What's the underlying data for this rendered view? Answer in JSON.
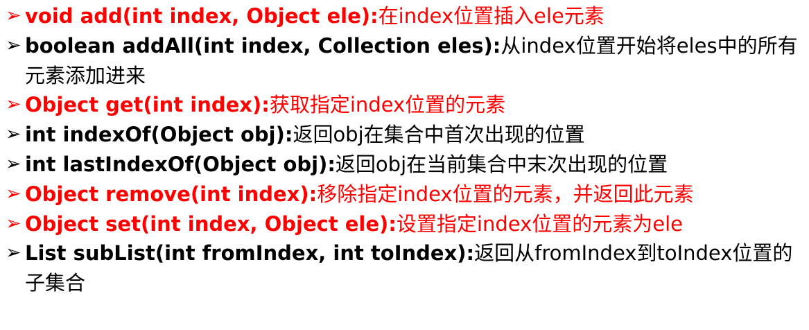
{
  "bullet": "➢",
  "items": [
    {
      "signature": "void add(int index, Object ele):",
      "description": "在index位置插入ele元素",
      "color": "red"
    },
    {
      "signature": "boolean addAll(int index, Collection eles):",
      "description": "从index位置开始将eles中的所有元素添加进来",
      "color": "black"
    },
    {
      "signature": "Object get(int index):",
      "description": "获取指定index位置的元素",
      "color": "red"
    },
    {
      "signature": "int indexOf(Object obj):",
      "description": "返回obj在集合中首次出现的位置",
      "color": "black"
    },
    {
      "signature": "int lastIndexOf(Object obj):",
      "description": "返回obj在当前集合中末次出现的位置",
      "color": "black"
    },
    {
      "signature": "Object remove(int index):",
      "description": "移除指定index位置的元素，并返回此元素",
      "color": "red"
    },
    {
      "signature": "Object set(int index, Object ele):",
      "description": "设置指定index位置的元素为ele",
      "color": "red"
    },
    {
      "signature": "List subList(int fromIndex, int toIndex):",
      "description": "返回从fromIndex到toIndex位置的子集合",
      "color": "black"
    }
  ]
}
